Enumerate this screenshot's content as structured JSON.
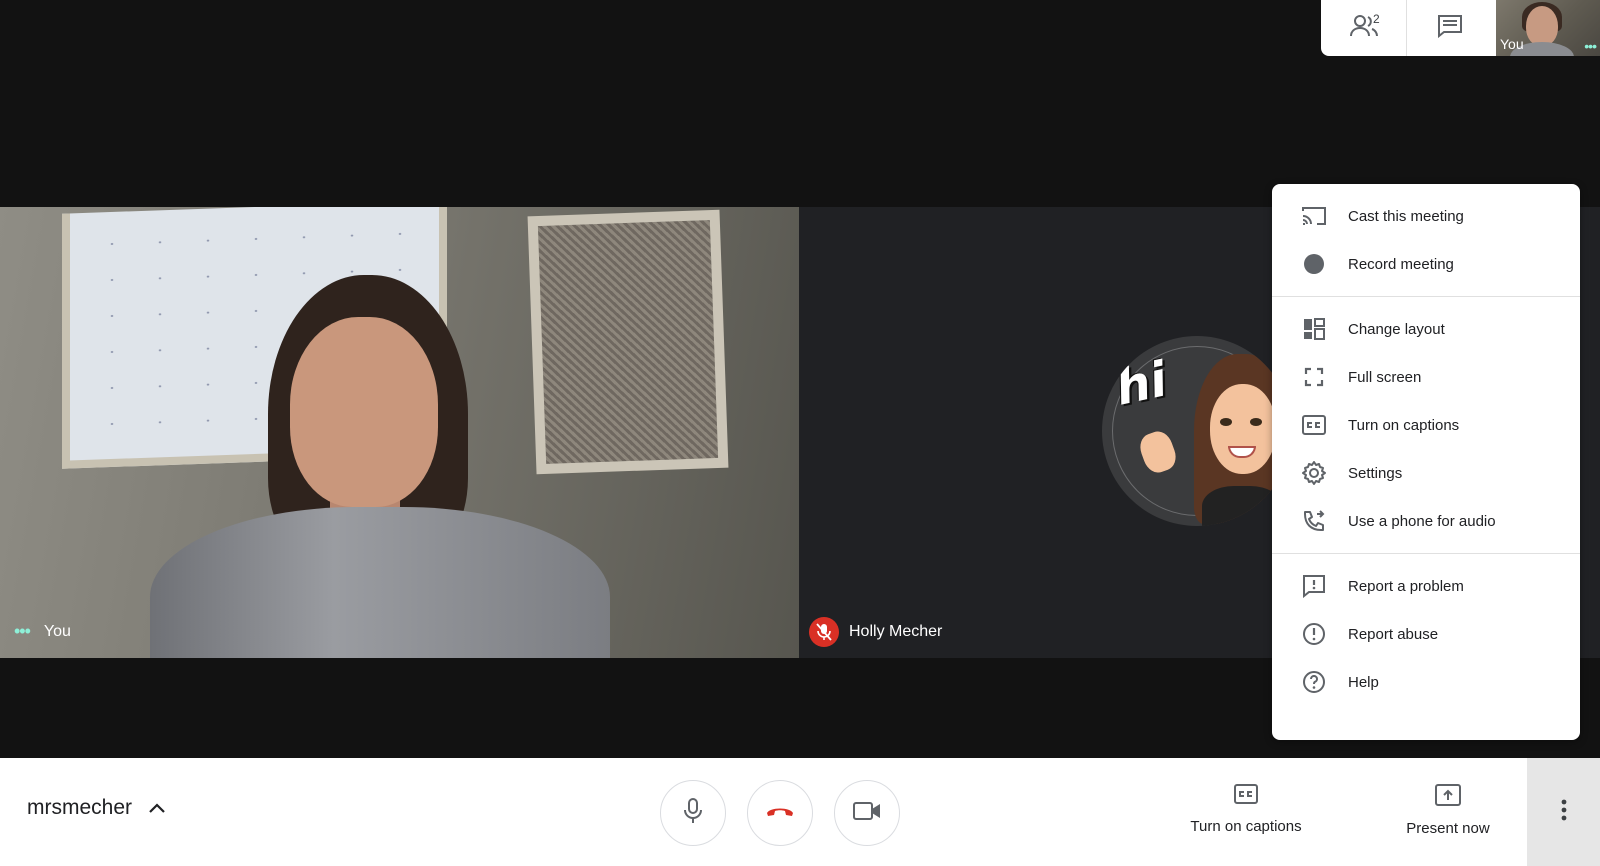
{
  "top_panel": {
    "people_count": "2",
    "self_label": "You"
  },
  "tiles": {
    "you": {
      "name": "You"
    },
    "holly": {
      "name": "Holly Mecher",
      "avatar_text": "hi"
    }
  },
  "menu": {
    "items": [
      {
        "label": "Cast this meeting",
        "icon": "cast-icon"
      },
      {
        "label": "Record meeting",
        "icon": "record-icon"
      },
      {
        "label": "Change layout",
        "icon": "layout-icon"
      },
      {
        "label": "Full screen",
        "icon": "fullscreen-icon"
      },
      {
        "label": "Turn on captions",
        "icon": "captions-icon"
      },
      {
        "label": "Settings",
        "icon": "gear-icon"
      },
      {
        "label": "Use a phone for audio",
        "icon": "phone-icon"
      },
      {
        "label": "Report a problem",
        "icon": "feedback-icon"
      },
      {
        "label": "Report abuse",
        "icon": "warning-icon"
      },
      {
        "label": "Help",
        "icon": "help-icon"
      }
    ]
  },
  "bottom_bar": {
    "meeting_name": "mrsmecher",
    "captions_label": "Turn on captions",
    "present_label": "Present now"
  },
  "colors": {
    "background": "#121212",
    "hangup_red": "#d93025",
    "accent_dots": "#8ef0d8"
  }
}
